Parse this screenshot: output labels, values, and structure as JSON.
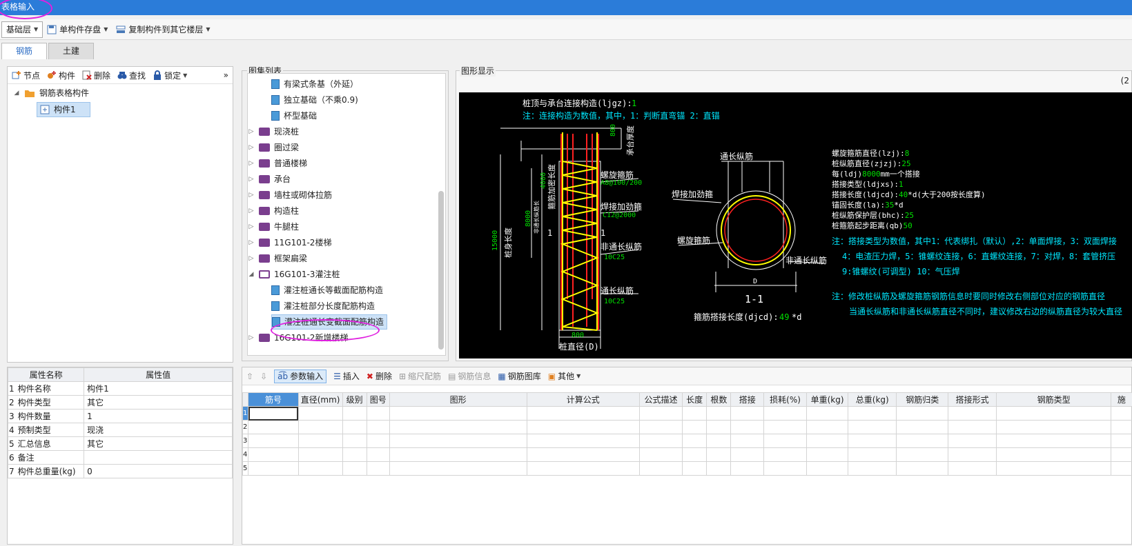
{
  "window": {
    "title": "表格输入"
  },
  "toolbar": {
    "floor_select": "基础层",
    "save_component": "单构件存盘",
    "copy_component": "复制构件到其它楼层"
  },
  "tabs": [
    "钢筋",
    "土建"
  ],
  "left_toolbar": {
    "node": "节点",
    "component": "构件",
    "delete": "删除",
    "find": "查找",
    "lock": "锁定"
  },
  "tree": {
    "root": "钢筋表格构件",
    "child": "构件1"
  },
  "properties": {
    "headers": [
      "属性名称",
      "属性值"
    ],
    "rows": [
      {
        "num": "1",
        "name": "构件名称",
        "value": "构件1"
      },
      {
        "num": "2",
        "name": "构件类型",
        "value": "其它"
      },
      {
        "num": "3",
        "name": "构件数量",
        "value": "1"
      },
      {
        "num": "4",
        "name": "预制类型",
        "value": "现浇"
      },
      {
        "num": "5",
        "name": "汇总信息",
        "value": "其它"
      },
      {
        "num": "6",
        "name": "备注",
        "value": ""
      },
      {
        "num": "7",
        "name": "构件总重量(kg)",
        "value": "0"
      }
    ]
  },
  "atlas": {
    "title": "图集列表",
    "items": [
      {
        "label": "有梁式条基（外延）",
        "type": "page",
        "level": 2
      },
      {
        "label": "独立基础（不乘0.9)",
        "type": "page",
        "level": 2
      },
      {
        "label": "杯型基础",
        "type": "page",
        "level": 2
      },
      {
        "label": "现浇桩",
        "type": "book",
        "level": 1
      },
      {
        "label": "圈过梁",
        "type": "book",
        "level": 1
      },
      {
        "label": "普通楼梯",
        "type": "book",
        "level": 1
      },
      {
        "label": "承台",
        "type": "book",
        "level": 1
      },
      {
        "label": "墙柱或砌体拉筋",
        "type": "book",
        "level": 1
      },
      {
        "label": "构造柱",
        "type": "book",
        "level": 1
      },
      {
        "label": "牛腿柱",
        "type": "book",
        "level": 1
      },
      {
        "label": "11G101-2楼梯",
        "type": "book",
        "level": 1
      },
      {
        "label": "框架扁梁",
        "type": "book",
        "level": 1
      },
      {
        "label": "16G101-3灌注桩",
        "type": "openbook",
        "level": 1
      },
      {
        "label": "灌注桩通长等截面配筋构造",
        "type": "page",
        "level": 2
      },
      {
        "label": "灌注桩部分长度配筋构造",
        "type": "page",
        "level": 2
      },
      {
        "label": "灌注桩通长变截面配筋构造",
        "type": "page",
        "level": 2,
        "selected": true
      },
      {
        "label": "16G101-2新增楼梯",
        "type": "book",
        "level": 1
      }
    ]
  },
  "figure": {
    "title": "图形显示",
    "corner": "(2",
    "line1": "桩顶与承台连接构造(ljgz):",
    "line1_val": "1",
    "line2": "注：连接构造为数值，其中，1：判断直弯锚     2：直锚",
    "labels": {
      "spiral": "螺旋箍筋",
      "spiral_val": "A8@100/200",
      "weld": "焊接加劲箍",
      "weld_val": "C12@2000",
      "nonfull": "非通长纵筋",
      "nonfull_val": "10C25",
      "full": "通长纵筋",
      "full_val": "10C25",
      "dim800_top": "800",
      "cap": "承台厚度",
      "dense": "箍筋加密长度",
      "dim4000": "4000",
      "dim8000": "8000",
      "nonfull_len": "非通长纵筋长",
      "dim15000": "15000",
      "pile_len": "桩身长度",
      "dim800_bot": "800",
      "diam": "桩直径(D)",
      "one": "1",
      "sec_full": "通长纵筋",
      "sec_weld": "焊接加劲箍",
      "sec_spiral": "螺旋箍筋",
      "sec_nonfull": "非通长纵筋",
      "sec_d": "D",
      "sec_title": "1-1",
      "lap": "箍筋搭接长度(djcd):",
      "lap_val": "49",
      "lap_unit": "*d"
    },
    "params": [
      {
        "k": "螺旋箍筋直径(lzj):",
        "v": "8",
        "u": ""
      },
      {
        "k": "桩纵筋直径(zjzj):",
        "v": "25",
        "u": ""
      },
      {
        "k": "每(ldj)",
        "v": "8000",
        "u": "mm一个搭接"
      },
      {
        "k": "搭接类型(ldjxs):",
        "v": "1",
        "u": ""
      },
      {
        "k": "搭接长度(ldjcd):",
        "v": "40",
        "u": "*d(大于200按长度算)"
      },
      {
        "k": "锚固长度(la):",
        "v": "35",
        "u": "*d"
      },
      {
        "k": "桩纵筋保护层(bhc):",
        "v": "25",
        "u": ""
      },
      {
        "k": "桩箍筋起步距离(qb)",
        "v": "50",
        "u": ""
      }
    ],
    "notes": [
      "注：搭接类型为数值，其中1：代表绑扎（默认）,2：单面焊接，3：双面焊接",
      "4：电渣压力焊，5：锥螺纹连接，6：直螺纹连接，7：对焊，8：套管挤压",
      "9:锥螺纹(可调型) 10：气压焊",
      "注：修改桩纵筋及螺旋箍筋钢筋信息时要同时修改右侧部位对应的钢筋直径",
      "当通长纵筋和非通长纵筋直径不同时，建议修改右边的纵筋直径为较大直径"
    ]
  },
  "bottom_toolbar": {
    "param_input": "参数输入",
    "insert": "插入",
    "delete": "删除",
    "scale": "缩尺配筋",
    "rebar_info": "钢筋信息",
    "rebar_lib": "钢筋图库",
    "other": "其他"
  },
  "grid": {
    "headers": [
      "筋号",
      "直径(mm)",
      "级别",
      "图号",
      "图形",
      "计算公式",
      "公式描述",
      "长度",
      "根数",
      "搭接",
      "损耗(%)",
      "单重(kg)",
      "总重(kg)",
      "钢筋归类",
      "搭接形式",
      "钢筋类型",
      "施"
    ],
    "rows": [
      "1",
      "2",
      "3",
      "4",
      "5"
    ]
  },
  "colors": {
    "title_bar": "#2b7cd9",
    "highlight": "#e020e0",
    "cad_bg": "#000000",
    "cad_green": "#00e000",
    "cad_cyan": "#00e8ff",
    "cad_yellow": "#ffff00",
    "cad_red": "#ff2020"
  }
}
